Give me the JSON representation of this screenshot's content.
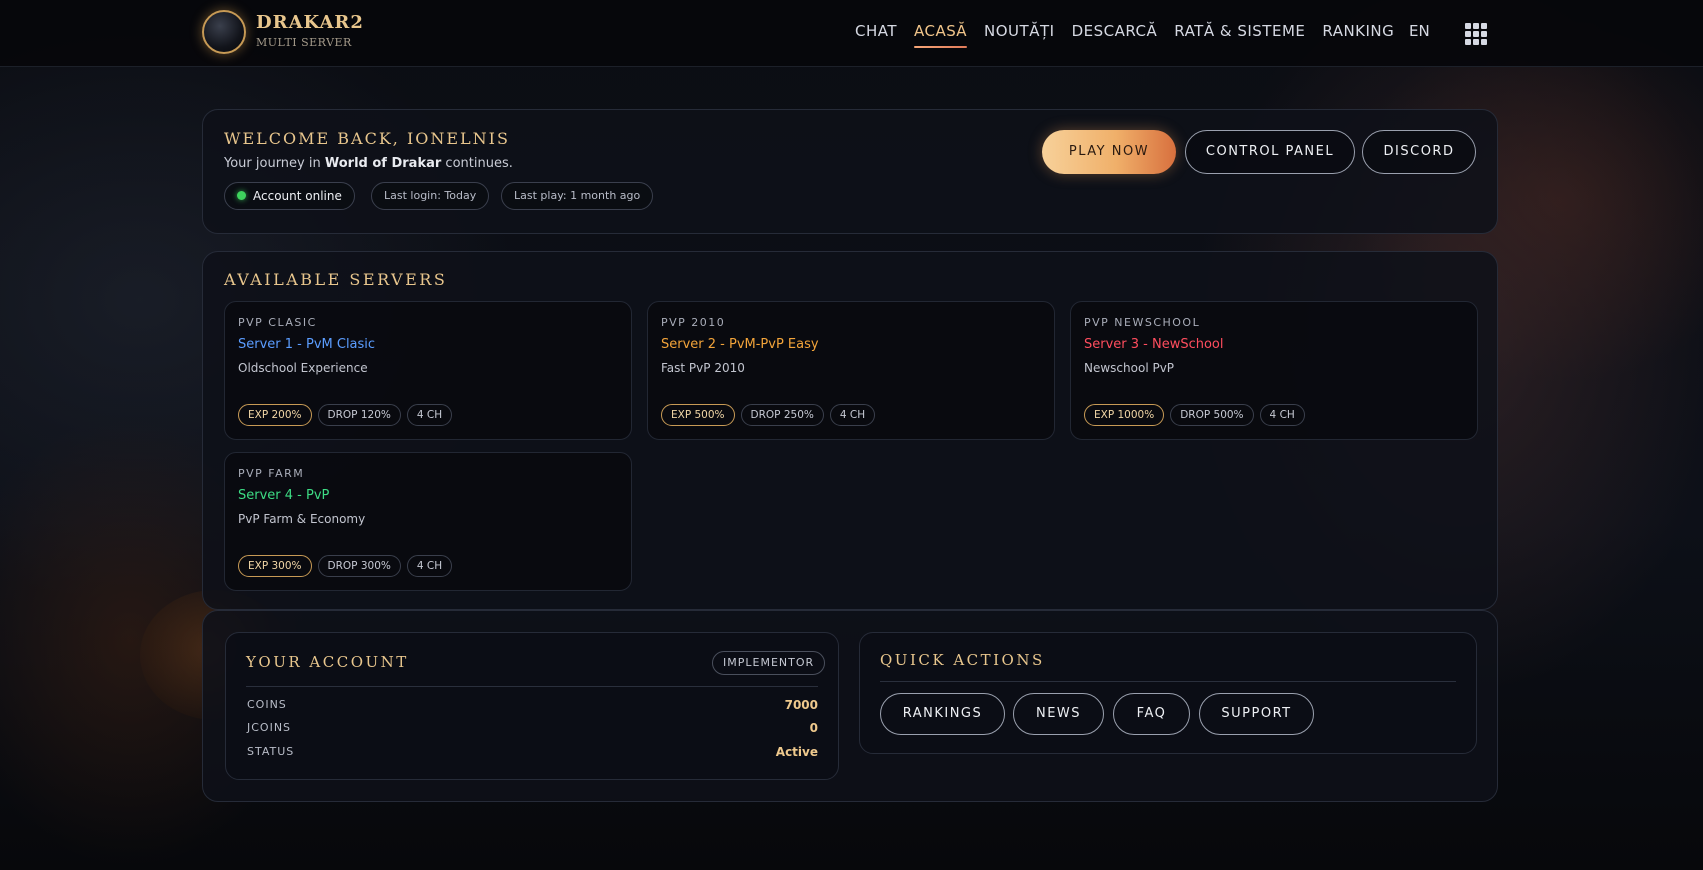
{
  "brand": {
    "title": "DRAKAR2",
    "subtitle": "MULTI SERVER"
  },
  "nav": {
    "items": [
      {
        "label": "CHAT",
        "active": false
      },
      {
        "label": "ACASĂ",
        "active": true
      },
      {
        "label": "NOUTĂȚI",
        "active": false
      },
      {
        "label": "DESCARCĂ",
        "active": false
      },
      {
        "label": "RATĂ & SISTEME",
        "active": false
      },
      {
        "label": "RANKING",
        "active": false
      }
    ],
    "language": "EN",
    "apps_icon": "grid-icon"
  },
  "welcome": {
    "title": "WELCOME BACK, IONELNIS",
    "text_before": "Your journey in ",
    "world": "World of Drakar",
    "text_after": " continues.",
    "status": "Account online",
    "last_login": "Last login: Today",
    "last_play": "Last play: 1 month ago",
    "buttons": {
      "play": "PLAY NOW",
      "control_panel": "CONTROL PANEL",
      "discord": "DISCORD"
    }
  },
  "servers": {
    "title": "AVAILABLE SERVERS",
    "cards": [
      {
        "type": "PVP CLASIC",
        "name": "Server 1 - PvM Clasic",
        "color": "#5b9dff",
        "desc": "Oldschool Experience",
        "exp": "EXP 200%",
        "drop": "DROP 120%",
        "ch": "4 CH"
      },
      {
        "type": "PVP 2010",
        "name": "Server 2 - PvM-PvP Easy",
        "color": "#f3a43a",
        "desc": "Fast PvP 2010",
        "exp": "EXP 500%",
        "drop": "DROP 250%",
        "ch": "4 CH"
      },
      {
        "type": "PVP NEWSCHOOL",
        "name": "Server 3 - NewSchool",
        "color": "#ff4d5e",
        "desc": "Newschool PvP",
        "exp": "EXP 1000%",
        "drop": "DROP 500%",
        "ch": "4 CH"
      },
      {
        "type": "PVP FARM",
        "name": "Server 4 - PvP",
        "color": "#3ddc84",
        "desc": "PvP Farm & Economy",
        "exp": "EXP 300%",
        "drop": "DROP 300%",
        "ch": "4 CH"
      }
    ]
  },
  "account": {
    "title": "YOUR ACCOUNT",
    "role": "IMPLEMENTOR",
    "rows": [
      {
        "label": "COINS",
        "value": "7000"
      },
      {
        "label": "JCOINS",
        "value": "0"
      },
      {
        "label": "STATUS",
        "value": "Active"
      }
    ]
  },
  "quick": {
    "title": "QUICK ACTIONS",
    "buttons": [
      "RANKINGS",
      "NEWS",
      "FAQ",
      "SUPPORT"
    ]
  },
  "colors": {
    "accent": "#e8c68d",
    "play_gradient_start": "#f7d19a",
    "play_gradient_end": "#d8703e",
    "online": "#3ed35d"
  }
}
